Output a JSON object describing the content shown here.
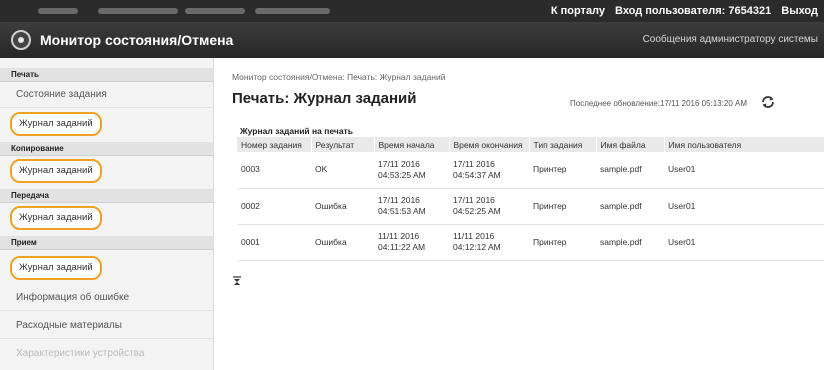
{
  "topbar": {
    "portal_link": "К порталу",
    "login_label": "Вход пользователя:",
    "login_user": "7654321",
    "logout_link": "Выход"
  },
  "header": {
    "title": "Монитор состояния/Отмена",
    "admin_link": "Сообщения администратору системы"
  },
  "sidebar": {
    "sections": [
      {
        "heading": "Печать",
        "items": [
          "Состояние задания",
          "Журнал заданий"
        ]
      },
      {
        "heading": "Копирование",
        "items": [
          "Журнал заданий"
        ]
      },
      {
        "heading": "Передача",
        "items": [
          "Журнал заданий"
        ]
      },
      {
        "heading": "Прием",
        "items": [
          "Журнал заданий"
        ]
      }
    ],
    "other_items": [
      "Информация об ошибке",
      "Расходные материалы",
      "Характеристики устройства"
    ],
    "highlight_color": "#f0a024"
  },
  "main": {
    "breadcrumb": "Монитор состояния/Отмена: Печать: Журнал заданий",
    "title": "Печать: Журнал заданий",
    "last_updated": "Последнее обновление:17/11 2016 05:13:20 AM",
    "table_caption": "Журнал заданий на печать",
    "columns": [
      "Номер задания",
      "Результат",
      "Время начала",
      "Время окончания",
      "Тип задания",
      "Имя файла",
      "Имя пользователя"
    ],
    "rows": [
      {
        "num": "0003",
        "result": "OK",
        "start_date": "17/11 2016",
        "start_time": "04:53:25 AM",
        "end_date": "17/11 2016",
        "end_time": "04:54:37 AM",
        "type": "Принтер",
        "file": "sample.pdf",
        "user": "User01"
      },
      {
        "num": "0002",
        "result": "Ошибка",
        "start_date": "17/11 2016",
        "start_time": "04:51:53 AM",
        "end_date": "17/11 2016",
        "end_time": "04:52:25 AM",
        "type": "Принтер",
        "file": "sample.pdf",
        "user": "User01"
      },
      {
        "num": "0001",
        "result": "Ошибка",
        "start_date": "11/11 2016",
        "start_time": "04:11:22 AM",
        "end_date": "11/11 2016",
        "end_time": "04:12:12 AM",
        "type": "Принтер",
        "file": "sample.pdf",
        "user": "User01"
      }
    ]
  },
  "icons": {
    "logo": "device-logo-icon",
    "refresh": "refresh-icon",
    "collapse": "collapse-icon"
  }
}
